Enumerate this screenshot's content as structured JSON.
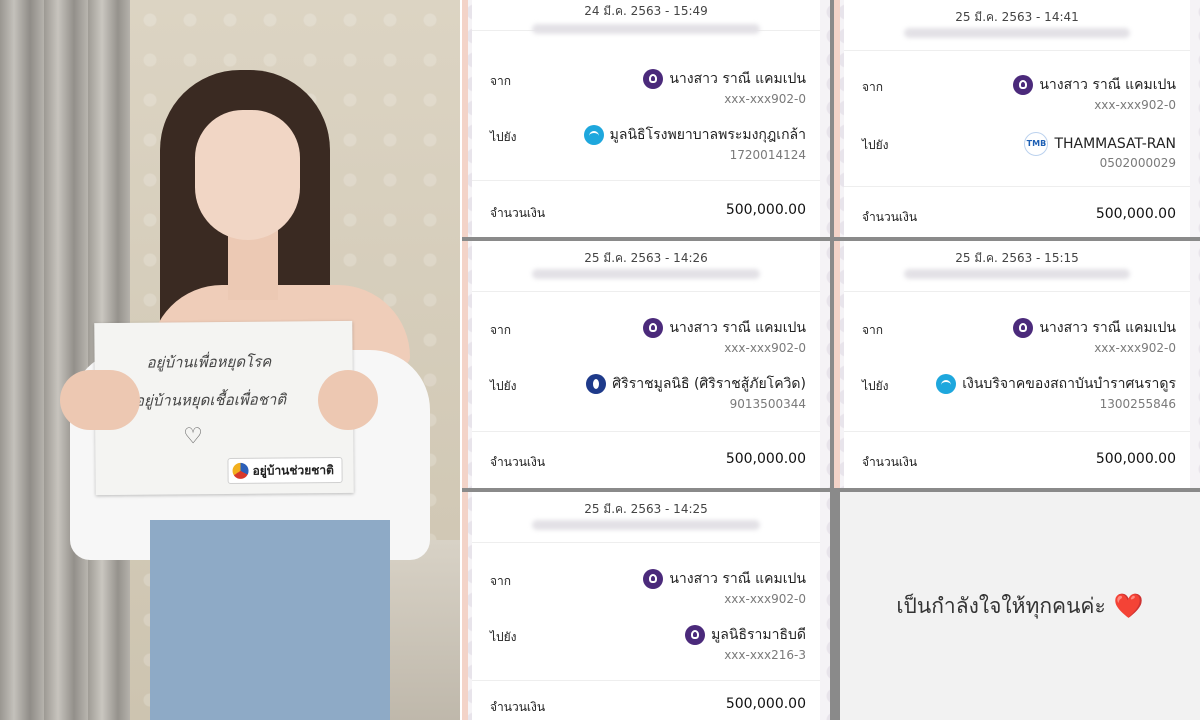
{
  "sign": {
    "line1": "อยู่บ้านเพื่อหยุดโรค",
    "line2": "อยู่บ้านหยุดเชื้อเพื่อชาติ",
    "heart": "♡",
    "logo_text": "อยู่บ้านช่วยชาติ"
  },
  "labels": {
    "from": "จาก",
    "to": "ไปยัง",
    "amount": "จำนวนเงิน"
  },
  "receipts": [
    {
      "datetime": "24 มี.ค. 2563 - 15:49",
      "from_name": "นางสาว ราณี แคมเปน",
      "from_account": "xxx-xxx902-0",
      "to_name": "มูลนิธิโรงพยาบาลพระมงกุฎเกล้า",
      "to_account": "1720014124",
      "to_icon": "ktb-bank-icon",
      "amount": "500,000.00"
    },
    {
      "datetime": "25 มี.ค. 2563 - 14:41",
      "from_name": "นางสาว ราณี แคมเปน",
      "from_account": "xxx-xxx902-0",
      "to_name": "THAMMASAT-RAN",
      "to_account": "0502000029",
      "to_icon": "tmb-bank-icon",
      "to_icon_text": "TMB",
      "amount": "500,000.00"
    },
    {
      "datetime": "25 มี.ค. 2563 - 14:26",
      "from_name": "นางสาว ราณี แคมเปน",
      "from_account": "xxx-xxx902-0",
      "to_name": "ศิริราชมูลนิธิ (ศิริราชสู้ภัยโควิด)",
      "to_account": "9013500344",
      "to_icon": "bay-bank-icon",
      "amount": "500,000.00"
    },
    {
      "datetime": "25 มี.ค. 2563 - 15:15",
      "from_name": "นางสาว ราณี แคมเปน",
      "from_account": "xxx-xxx902-0",
      "to_name": "เงินบริจาคของสถาบันบำราศนราดูร",
      "to_account": "1300255846",
      "to_icon": "ktb-bank-icon",
      "amount": "500,000.00"
    },
    {
      "datetime": "25 มี.ค. 2563 - 14:25",
      "from_name": "นางสาว ราณี แคมเปน",
      "from_account": "xxx-xxx902-0",
      "to_name": "มูลนิธิรามาธิบดี",
      "to_account": "xxx-xxx216-3",
      "to_icon": "scb-bank-icon",
      "amount": "500,000.00"
    }
  ],
  "message": {
    "text": "เป็นกำลังใจให้ทุกคนค่ะ",
    "emoji": "❤️"
  },
  "colors": {
    "scb_purple": "#4b2a7b",
    "ktb_blue": "#1ea7dd",
    "accent_strip": "#f3d3c8",
    "heart_red": "#e0242f"
  }
}
